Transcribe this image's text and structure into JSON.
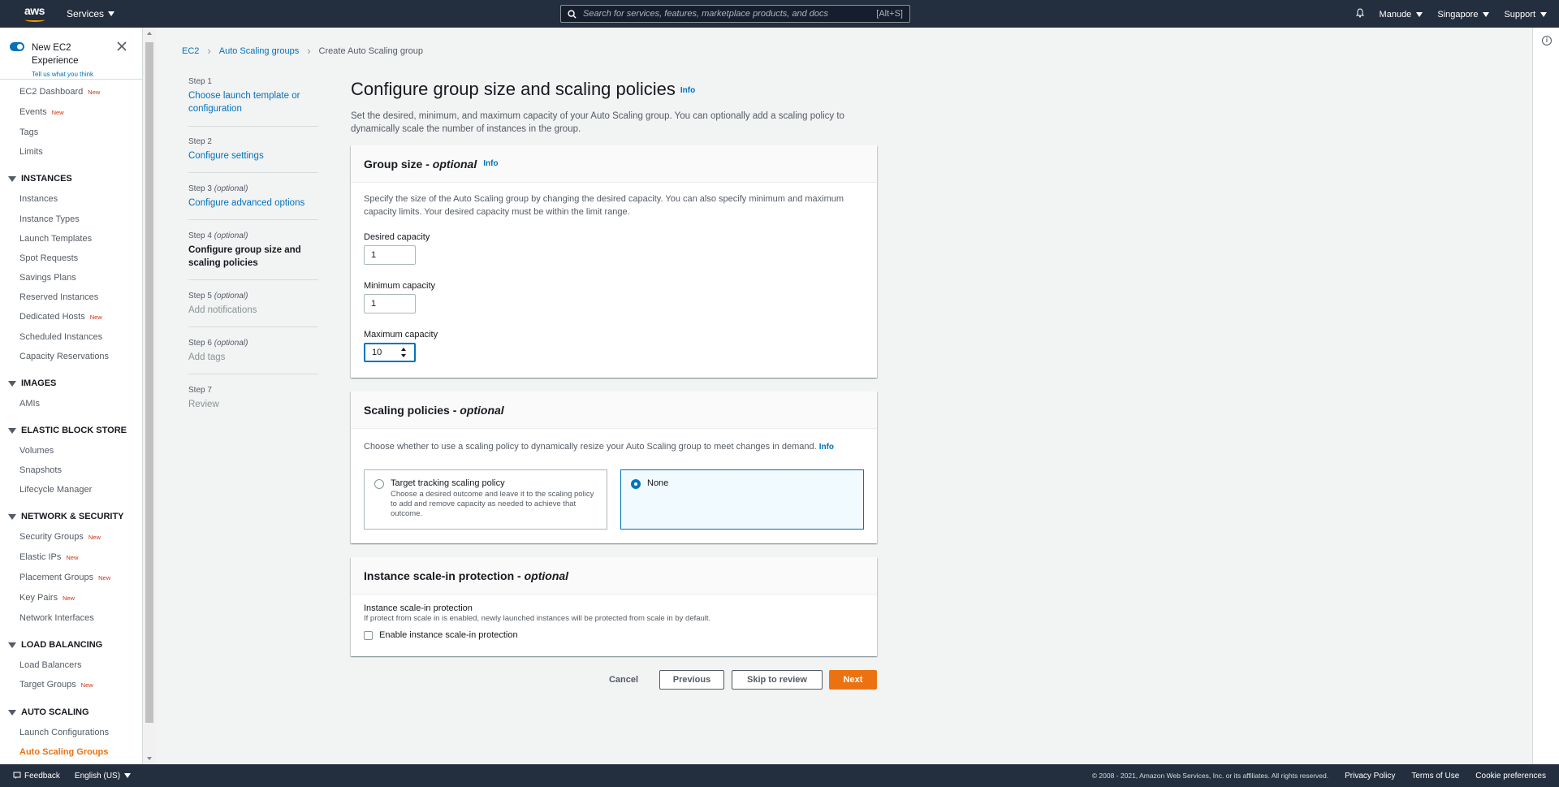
{
  "topnav": {
    "logo": "aws",
    "services_label": "Services",
    "search_placeholder": "Search for services, features, marketplace products, and docs",
    "search_shortcut": "[Alt+S]",
    "account": "Manude",
    "region": "Singapore",
    "support": "Support"
  },
  "sidebar": {
    "new_experience": "New EC2 Experience",
    "tell_us": "Tell us what you think",
    "new_badge": "New",
    "top_items": [
      {
        "label": "EC2 Dashboard",
        "new": true
      },
      {
        "label": "Events",
        "new": true
      },
      {
        "label": "Tags",
        "new": false
      },
      {
        "label": "Limits",
        "new": false
      }
    ],
    "sections": [
      {
        "title": "INSTANCES",
        "items": [
          "Instances",
          "Instance Types",
          "Launch Templates",
          "Spot Requests",
          "Savings Plans",
          "Reserved Instances",
          "Dedicated Hosts",
          "Scheduled Instances",
          "Capacity Reservations"
        ]
      },
      {
        "title": "IMAGES",
        "items": [
          "AMIs"
        ]
      },
      {
        "title": "ELASTIC BLOCK STORE",
        "items": [
          "Volumes",
          "Snapshots",
          "Lifecycle Manager"
        ]
      },
      {
        "title": "NETWORK & SECURITY",
        "items": [
          "Security Groups",
          "Elastic IPs",
          "Placement Groups",
          "Key Pairs",
          "Network Interfaces"
        ]
      },
      {
        "title": "LOAD BALANCING",
        "items": [
          "Load Balancers",
          "Target Groups"
        ]
      },
      {
        "title": "AUTO SCALING",
        "items": [
          "Launch Configurations",
          "Auto Scaling Groups"
        ]
      }
    ]
  },
  "breadcrumb": [
    "EC2",
    "Auto Scaling groups",
    "Create Auto Scaling group"
  ],
  "steps": [
    {
      "num": "Step 1",
      "opt": "",
      "label": "Choose launch template or configuration",
      "state": "link"
    },
    {
      "num": "Step 2",
      "opt": "",
      "label": "Configure settings",
      "state": "link"
    },
    {
      "num": "Step 3",
      "opt": "(optional)",
      "label": "Configure advanced options",
      "state": "link"
    },
    {
      "num": "Step 4",
      "opt": "(optional)",
      "label": "Configure group size and scaling policies",
      "state": "current"
    },
    {
      "num": "Step 5",
      "opt": "(optional)",
      "label": "Add notifications",
      "state": "disabled"
    },
    {
      "num": "Step 6",
      "opt": "(optional)",
      "label": "Add tags",
      "state": "disabled"
    },
    {
      "num": "Step 7",
      "opt": "",
      "label": "Review",
      "state": "disabled"
    }
  ],
  "main": {
    "title": "Configure group size and scaling policies",
    "info": "Info",
    "description": "Set the desired, minimum, and maximum capacity of your Auto Scaling group. You can optionally add a scaling policy to dynamically scale the number of instances in the group."
  },
  "group_size": {
    "title": "Group size -",
    "optional": "optional",
    "info": "Info",
    "description": "Specify the size of the Auto Scaling group by changing the desired capacity. You can also specify minimum and maximum capacity limits. Your desired capacity must be within the limit range.",
    "desired_label": "Desired capacity",
    "desired_value": "1",
    "min_label": "Minimum capacity",
    "min_value": "1",
    "max_label": "Maximum capacity",
    "max_value": "10"
  },
  "scaling_policies": {
    "title": "Scaling policies -",
    "optional": "optional",
    "description": "Choose whether to use a scaling policy to dynamically resize your Auto Scaling group to meet changes in demand.",
    "info": "Info",
    "option1_title": "Target tracking scaling policy",
    "option1_desc": "Choose a desired outcome and leave it to the scaling policy to add and remove capacity as needed to achieve that outcome.",
    "option2_title": "None",
    "selected": "None"
  },
  "scale_in": {
    "title": "Instance scale-in protection -",
    "optional": "optional",
    "field_label": "Instance scale-in protection",
    "field_desc": "If protect from scale in is enabled, newly launched instances will be protected from scale in by default.",
    "checkbox_label": "Enable instance scale-in protection",
    "checked": false
  },
  "actions": {
    "cancel": "Cancel",
    "previous": "Previous",
    "skip": "Skip to review",
    "next": "Next"
  },
  "footer": {
    "feedback": "Feedback",
    "language": "English (US)",
    "copyright": "© 2008 - 2021, Amazon Web Services, Inc. or its affiliates. All rights reserved.",
    "privacy": "Privacy Policy",
    "terms": "Terms of Use",
    "cookies": "Cookie preferences"
  },
  "colors": {
    "nav_bg": "#232f3e",
    "accent": "#ec7211",
    "link": "#0073bb"
  }
}
